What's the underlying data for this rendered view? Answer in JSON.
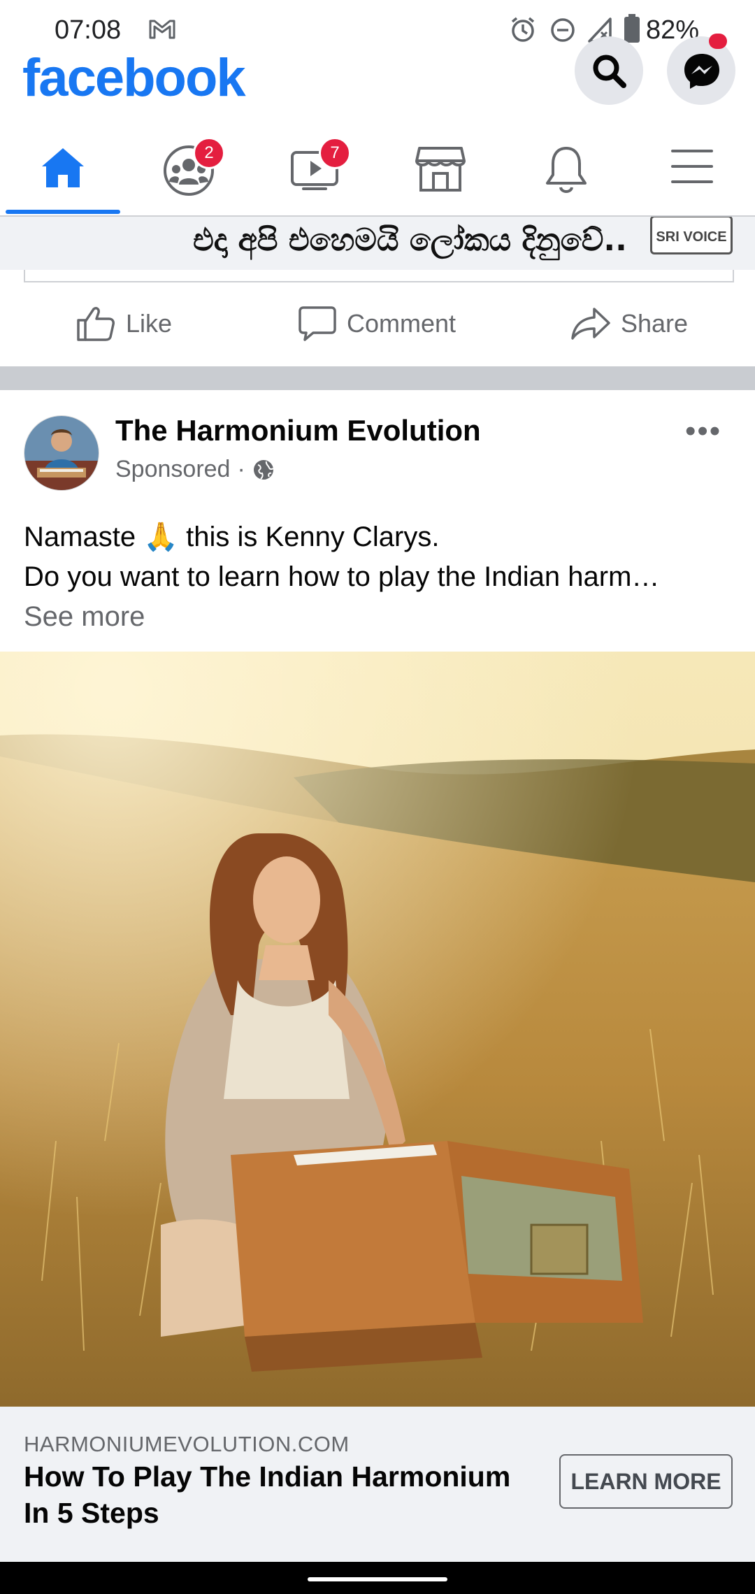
{
  "status_bar": {
    "time": "07:08",
    "battery": "82%",
    "icons": [
      "gmail-icon",
      "alarm-icon",
      "dnd-icon",
      "signal-icon",
      "battery-icon"
    ]
  },
  "header": {
    "logo": "facebook",
    "actions": [
      "search-icon",
      "messenger-icon"
    ]
  },
  "nav": {
    "tabs": [
      {
        "name": "home",
        "icon": "home-icon",
        "active": true
      },
      {
        "name": "groups",
        "icon": "groups-icon",
        "badge": "2"
      },
      {
        "name": "watch",
        "icon": "video-icon",
        "badge": "7"
      },
      {
        "name": "marketplace",
        "icon": "store-icon"
      },
      {
        "name": "notifications",
        "icon": "bell-icon"
      },
      {
        "name": "menu",
        "icon": "menu-icon"
      }
    ]
  },
  "previous_post": {
    "banner_text": "එදා අපි එහෙමයි ලෝකය දිනුවේ..",
    "banner_logo": "SRI VOICE",
    "actions": {
      "like": "Like",
      "comment": "Comment",
      "share": "Share"
    }
  },
  "post": {
    "page_name": "The Harmonium Evolution",
    "sponsored": "Sponsored",
    "text_line1": "Namaste 🙏 this is Kenny Clarys.",
    "text_line2": "Do you want to learn how to play the Indian harm…",
    "see_more": "See more",
    "link": {
      "domain": "HARMONIUMEVOLUTION.COM",
      "headline": "How To Play The Indian Harmonium In 5 Steps",
      "cta": "LEARN MORE"
    }
  },
  "colors": {
    "brand": "#1877f2",
    "badge": "#e41e3f",
    "secondary_text": "#65676b"
  }
}
